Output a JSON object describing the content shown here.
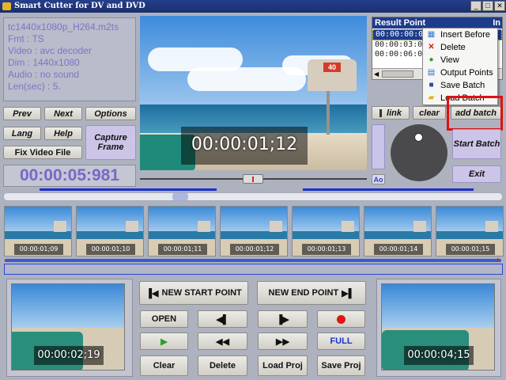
{
  "window": {
    "title": "Smart Cutter for DV and DVD",
    "controls": [
      "_",
      "□",
      "✕"
    ]
  },
  "info": {
    "file": "tc1440x1080p_H264.m2ts",
    "fmt": "Fmt : TS",
    "video": "Video : avc decoder",
    "dim": "Dim : 1440x1080",
    "audio": "Audio : no sound",
    "len": "Len(sec) : 5."
  },
  "buttons": {
    "prev": "Prev",
    "next": "Next",
    "options": "Options",
    "lang": "Lang",
    "help": "Help",
    "capture": "Capture Frame",
    "fix": "Fix Video File",
    "link": "link",
    "clear": "clear",
    "add_batch": "add batch",
    "start_batch": "Start Batch",
    "exit": "Exit",
    "ao": "Ao"
  },
  "timer": "00:00:05:981",
  "video": {
    "timecode": "00:00:01;12",
    "tower_number": "40"
  },
  "result": {
    "header": "Result Point",
    "header_right": "In",
    "rows": [
      "00:00:00:00",
      "00:00:03:04",
      "00:00:06:08"
    ]
  },
  "context_menu": {
    "items": [
      {
        "label": "Insert Before",
        "icon": "insert-before-icon",
        "color": "#2b7ad8"
      },
      {
        "label": "Delete",
        "icon": "delete-x-icon",
        "color": "#d02020"
      },
      {
        "label": "View",
        "icon": "view-play-icon",
        "color": "#2aa02a"
      },
      {
        "label": "Output Points",
        "icon": "output-points-icon",
        "color": "#3a6ac8"
      },
      {
        "label": "Save Batch",
        "icon": "save-floppy-icon",
        "color": "#2a4aa8"
      },
      {
        "label": "Load Batch",
        "icon": "load-folder-icon",
        "color": "#e0b020"
      }
    ]
  },
  "thumbnails": [
    "00:00:01;09",
    "00:00:01;10",
    "00:00:01;11",
    "00:00:01;12",
    "00:00:01;13",
    "00:00:01;14",
    "00:00:01;15"
  ],
  "preview_start": "00:00:02;19",
  "preview_end": "00:00:04;15",
  "controls": {
    "new_start": "NEW START POINT",
    "new_end": "NEW END POINT",
    "open": "OPEN",
    "full": "FULL",
    "clear": "Clear",
    "delete": "Delete",
    "load_proj": "Load Proj",
    "save_proj": "Save Proj"
  }
}
